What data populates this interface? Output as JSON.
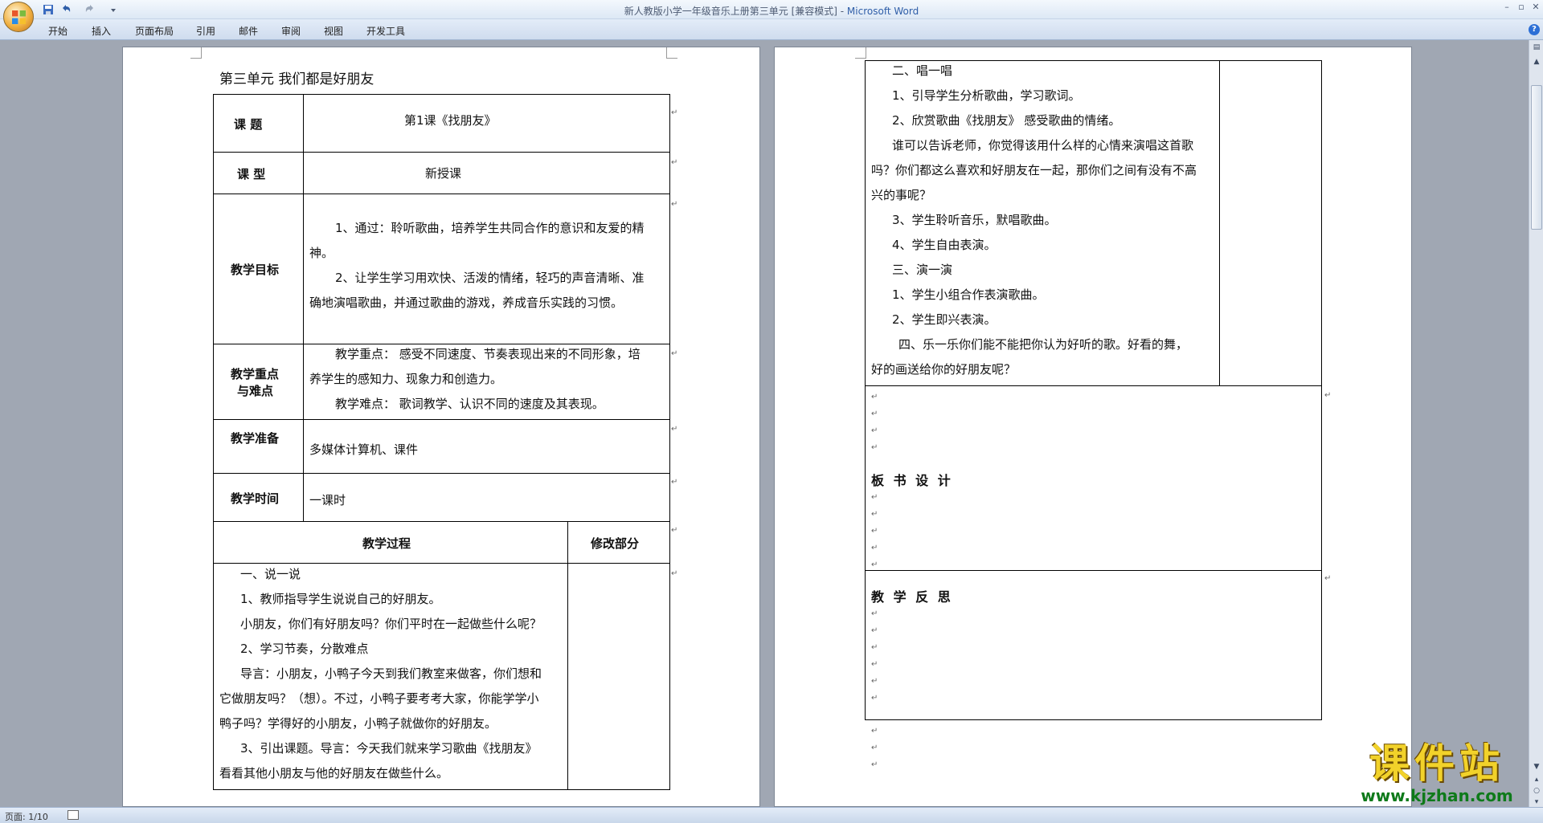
{
  "window": {
    "title_doc": "新人教版小学一年级音乐上册第三单元 [兼容模式] - ",
    "title_app": "Microsoft Word"
  },
  "ribbon": {
    "tabs": [
      "开始",
      "插入",
      "页面布局",
      "引用",
      "邮件",
      "审阅",
      "视图",
      "开发工具"
    ]
  },
  "status": {
    "page_count": "页面: 1/10"
  },
  "page1": {
    "unit_title": "第三单元 我们都是好朋友",
    "rows": {
      "topic_label": "课 题",
      "topic_value": "第1课《找朋友》",
      "type_label": "课 型",
      "type_value": "新授课",
      "goal_label": "教学目标",
      "goal_lines": [
        "1、通过：聆听歌曲，培养学生共同合作的意识和友爱的精",
        "神。",
        "2、让学生学习用欢快、活泼的情绪，轻巧的声音清晰、准",
        "确地演唱歌曲，并通过歌曲的游戏，养成音乐实践的习惯。"
      ],
      "key_label_1": "教学重点",
      "key_label_2": "与难点",
      "key_lines": [
        "教学重点： 感受不同速度、节奏表现出来的不同形象，培",
        "养学生的感知力、现象力和创造力。",
        "教学难点： 歌词教学、认识不同的速度及其表现。"
      ],
      "prep_label": "教学准备",
      "prep_value": "多媒体计算机、课件",
      "time_label": "教学时间",
      "time_value": "一课时",
      "process_label": "教学过程",
      "revise_label": "修改部分",
      "process_lines": [
        "一、说一说",
        "1、教师指导学生说说自己的好朋友。",
        "小朋友，你们有好朋友吗？你们平时在一起做些什么呢？",
        "2、学习节奏，分散难点",
        "导言：小朋友，小鸭子今天到我们教室来做客，你们想和",
        "它做朋友吗？（想）。不过，小鸭子要考考大家，你能学学小",
        "鸭子吗？学得好的小朋友，小鸭子就做你的好朋友。",
        "3、引出课题。导言：今天我们就来学习歌曲《找朋友》",
        "看看其他小朋友与他的好朋友在做些什么。"
      ]
    }
  },
  "page2": {
    "process_lines": [
      "二、唱一唱",
      "1、引导学生分析歌曲，学习歌词。",
      "2、欣赏歌曲《找朋友》 感受歌曲的情绪。",
      "谁可以告诉老师，你觉得该用什么样的心情来演唱这首歌",
      "吗？你们都这么喜欢和好朋友在一起，那你们之间有没有不高",
      "兴的事呢？",
      "3、学生聆听音乐，默唱歌曲。",
      "4、学生自由表演。",
      "三、演一演",
      "1、学生小组合作表演歌曲。",
      "2、学生即兴表演。",
      "四、乐一乐你们能不能把你认为好听的歌。好看的舞，",
      "好的画送给你的好朋友呢？"
    ],
    "board_label": "板 书 设 计",
    "reflect_label": "教 学 反 思"
  },
  "watermark": {
    "main": "课件站",
    "url": "www.kjzhan.com"
  }
}
